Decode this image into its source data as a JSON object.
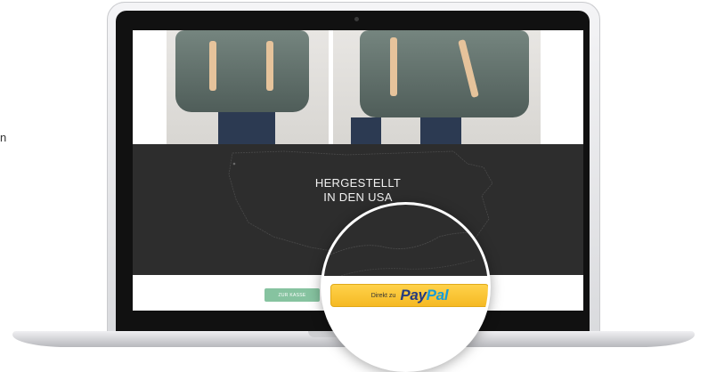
{
  "page": {
    "side_fragment": "n"
  },
  "screen": {
    "headline_line1": "HERGESTELLT",
    "headline_line2": "IN DEN USA",
    "checkout_label": "ZUR KASSE"
  },
  "magnifier": {
    "paypal_prefix": "Direkt zu",
    "paypal_logo_part1": "Pay",
    "paypal_logo_part2": "Pal"
  },
  "colors": {
    "dark_band": "#2d2d2d",
    "checkout_green": "#86c3a0",
    "paypal_yellow": "#f5b924",
    "paypal_navy": "#253b80",
    "paypal_blue": "#179bd7"
  }
}
